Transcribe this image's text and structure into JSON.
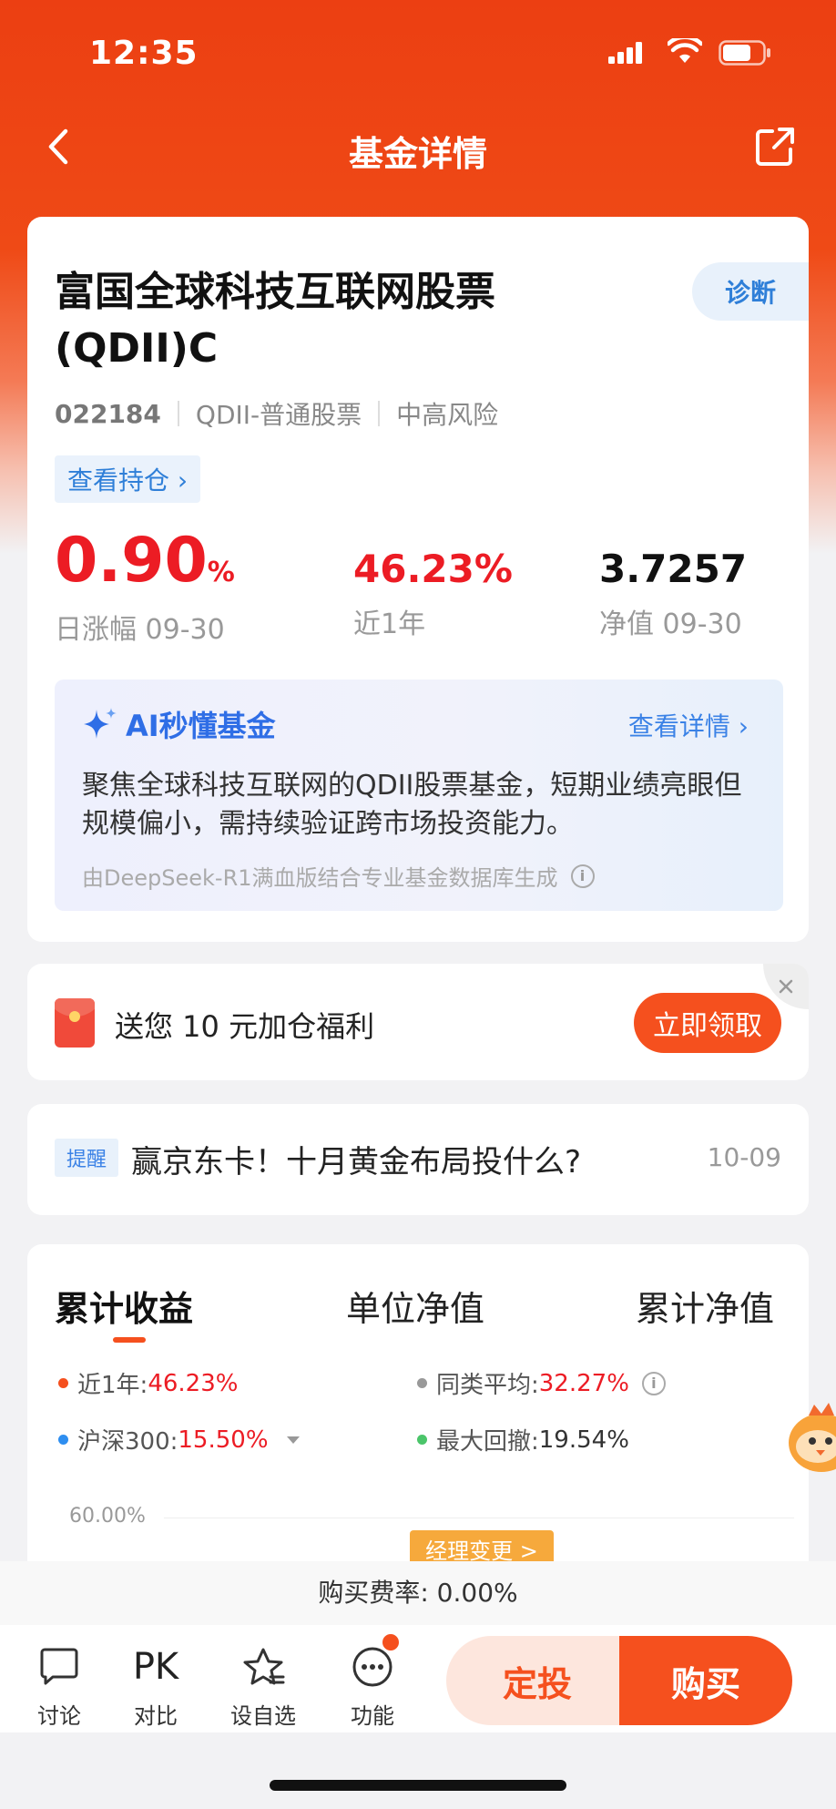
{
  "status_bar": {
    "time": "12:35"
  },
  "nav": {
    "title": "基金详情"
  },
  "fund": {
    "name": "富国全球科技互联网股票(QDII)C",
    "diagnose": "诊断",
    "code": "022184",
    "category": "QDII-普通股票",
    "risk": "中高风险",
    "holdings_link": "查看持仓 ›",
    "daily_change_value": "0.90",
    "daily_change_unit": "%",
    "daily_change_label": "日涨幅 09-30",
    "one_year_value": "46.23%",
    "one_year_label": "近1年",
    "nav_value": "3.7257",
    "nav_label": "净值 09-30"
  },
  "ai": {
    "title": "AI秒懂基金",
    "more": "查看详情 ›",
    "summary": "聚焦全球科技互联网的QDII股票基金，短期业绩亮眼但规模偏小，需持续验证跨市场投资能力。",
    "footer": "由DeepSeek-R1满血版结合专业基金数据库生成"
  },
  "promo": {
    "text": "送您 10 元加仓福利",
    "button": "立即领取"
  },
  "reminder": {
    "tag": "提醒",
    "text": "赢京东卡！十月黄金布局投什么?",
    "date": "10-09"
  },
  "chart_tabs": [
    "累计收益",
    "单位净值",
    "累计净值"
  ],
  "legend": {
    "one_year_label": "近1年:",
    "one_year_value": "46.23%",
    "peer_label": "同类平均:",
    "peer_value": "32.27%",
    "hs300_label": "沪深300:",
    "hs300_value": "15.50%",
    "drawdown_label": "最大回撤:",
    "drawdown_value": "19.54%"
  },
  "chart_axis_top": "60.00%",
  "manager_change": "经理变更 >",
  "fee": "购买费率: 0.00%",
  "toolbar": {
    "discuss": "讨论",
    "pk_glyph": "PK",
    "compare": "对比",
    "watchlist": "设自选",
    "functions": "功能",
    "dingtou": "定投",
    "buy": "购买"
  },
  "colors": {
    "brand": "#f5501e",
    "header": "#ec3f12",
    "up": "#ec1c24",
    "link": "#2f7fd8"
  }
}
